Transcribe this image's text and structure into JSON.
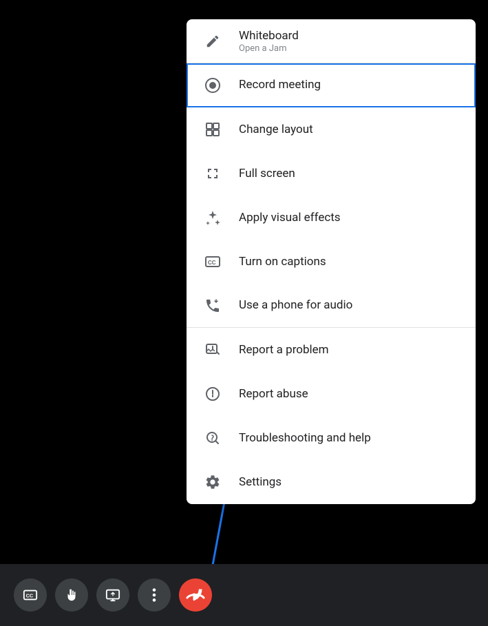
{
  "toolbar": {
    "buttons": [
      {
        "id": "captions-btn",
        "label": "CC",
        "icon": "captions-icon"
      },
      {
        "id": "raise-hand-btn",
        "label": "✋",
        "icon": "raise-hand-icon"
      },
      {
        "id": "present-btn",
        "label": "⬆",
        "icon": "present-icon"
      },
      {
        "id": "more-btn",
        "label": "⋮",
        "icon": "more-options-icon"
      },
      {
        "id": "end-call-btn",
        "label": "📞",
        "icon": "end-call-icon",
        "type": "end-call"
      }
    ]
  },
  "menu": {
    "items": [
      {
        "id": "whiteboard",
        "label": "Whiteboard",
        "sublabel": "Open a Jam",
        "icon": "pencil-icon",
        "divider": false,
        "highlighted": false
      },
      {
        "id": "record-meeting",
        "label": "Record meeting",
        "sublabel": "",
        "icon": "record-icon",
        "divider": true,
        "highlighted": true
      },
      {
        "id": "change-layout",
        "label": "Change layout",
        "sublabel": "",
        "icon": "layout-icon",
        "divider": false,
        "highlighted": false
      },
      {
        "id": "full-screen",
        "label": "Full screen",
        "sublabel": "",
        "icon": "fullscreen-icon",
        "divider": false,
        "highlighted": false
      },
      {
        "id": "visual-effects",
        "label": "Apply visual effects",
        "sublabel": "",
        "icon": "effects-icon",
        "divider": false,
        "highlighted": false
      },
      {
        "id": "captions",
        "label": "Turn on captions",
        "sublabel": "",
        "icon": "captions-icon",
        "divider": false,
        "highlighted": false
      },
      {
        "id": "phone-audio",
        "label": "Use a phone for audio",
        "sublabel": "",
        "icon": "phone-icon",
        "divider": true,
        "highlighted": false
      },
      {
        "id": "report-problem",
        "label": "Report a problem",
        "sublabel": "",
        "icon": "report-problem-icon",
        "divider": false,
        "highlighted": false
      },
      {
        "id": "report-abuse",
        "label": "Report abuse",
        "sublabel": "",
        "icon": "report-abuse-icon",
        "divider": false,
        "highlighted": false
      },
      {
        "id": "troubleshooting",
        "label": "Troubleshooting and help",
        "sublabel": "",
        "icon": "troubleshoot-icon",
        "divider": false,
        "highlighted": false
      },
      {
        "id": "settings",
        "label": "Settings",
        "sublabel": "",
        "icon": "settings-icon",
        "divider": false,
        "highlighted": false
      }
    ]
  },
  "arrow": {
    "color": "#1a73e8"
  }
}
